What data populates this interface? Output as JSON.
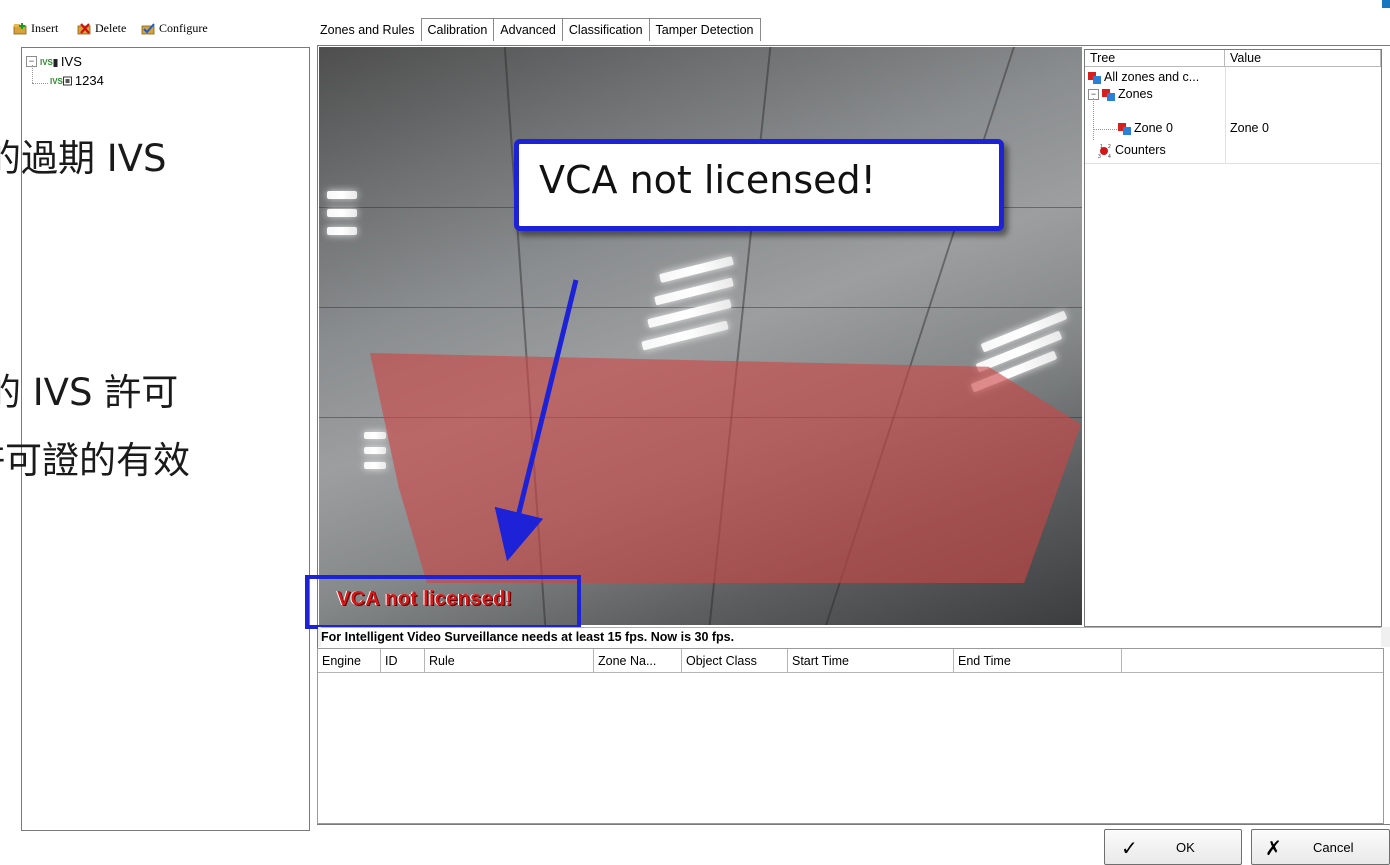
{
  "toolbar": {
    "insert_label": "Insert",
    "delete_label": "Delete",
    "configure_label": "Configure"
  },
  "left_tree": {
    "root_badge": "IVS",
    "root_label": "IVS",
    "child_badge": "IVS",
    "child_label": "1234"
  },
  "overlay_text": {
    "line1": "的過期 IVS",
    "line2": "的 IVS 許可",
    "line3": "許可證的有效"
  },
  "tabs": [
    {
      "label": "Zones and Rules"
    },
    {
      "label": "Calibration"
    },
    {
      "label": "Advanced"
    },
    {
      "label": "Classification"
    },
    {
      "label": "Tamper Detection"
    }
  ],
  "video": {
    "watermark": "VCA not licensed!"
  },
  "callout": {
    "text": "VCA not licensed!"
  },
  "property_tree": {
    "headers": {
      "tree": "Tree",
      "value": "Value"
    },
    "rows": [
      {
        "label": "All zones and c...",
        "value": ""
      },
      {
        "label": "Zones",
        "value": ""
      },
      {
        "label": "Zone 0",
        "value": "Zone 0"
      },
      {
        "label": "Counters",
        "value": ""
      }
    ]
  },
  "status": {
    "text": "For Intelligent Video Surveillance needs at least 15 fps. Now is 30 fps."
  },
  "events_table": {
    "columns": [
      "Engine",
      "ID",
      "Rule",
      "Zone Na...",
      "Object Class",
      "Start Time",
      "End Time"
    ],
    "rows": []
  },
  "buttons": {
    "ok_label": "OK",
    "cancel_label": "Cancel"
  },
  "colors": {
    "callout_border": "#1d22d6",
    "zone_fill": "#cd4646",
    "watermark": "#d41a1a"
  }
}
